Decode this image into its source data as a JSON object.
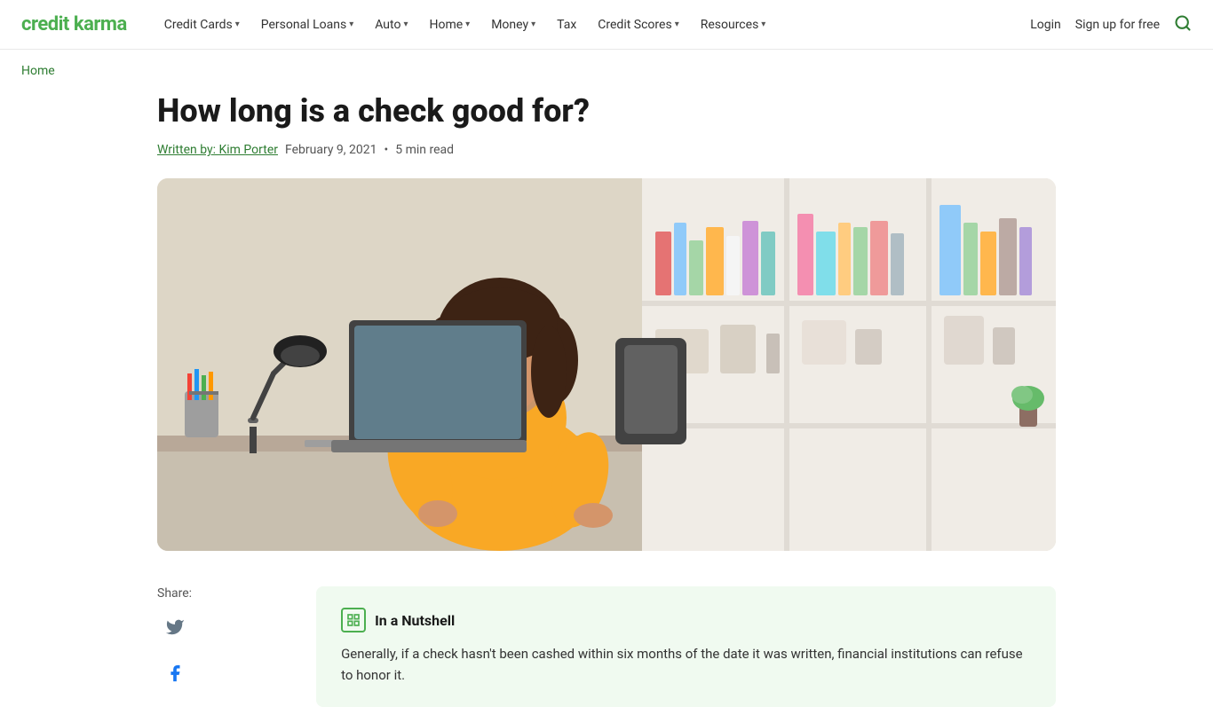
{
  "logo": {
    "text": "credit karma"
  },
  "nav": {
    "items": [
      {
        "label": "Credit Cards",
        "has_dropdown": true
      },
      {
        "label": "Personal Loans",
        "has_dropdown": true
      },
      {
        "label": "Auto",
        "has_dropdown": true
      },
      {
        "label": "Home",
        "has_dropdown": true
      },
      {
        "label": "Money",
        "has_dropdown": true
      },
      {
        "label": "Tax",
        "has_dropdown": false
      },
      {
        "label": "Credit Scores",
        "has_dropdown": true
      },
      {
        "label": "Resources",
        "has_dropdown": true
      }
    ],
    "login_label": "Login",
    "signup_label": "Sign up for free"
  },
  "breadcrumb": {
    "home_label": "Home"
  },
  "article": {
    "title": "How long is a check good for?",
    "author_label": "Written by: Kim Porter",
    "date": "February 9, 2021",
    "read_time": "5 min read",
    "dot_separator": "•"
  },
  "share": {
    "label": "Share:"
  },
  "nutshell": {
    "title": "In a Nutshell",
    "icon_symbol": "☐",
    "text": "Generally, if a check hasn't been cashed within six months of the date it was written, financial institutions can refuse to honor it."
  },
  "colors": {
    "green": "#4caf50",
    "dark_green": "#2e7d32",
    "light_green_bg": "#f0faf0"
  },
  "books": [
    {
      "color": "#e57373",
      "height": "60%"
    },
    {
      "color": "#90caf9",
      "height": "80%"
    },
    {
      "color": "#a5d6a7",
      "height": "50%"
    },
    {
      "color": "#ffb74d",
      "height": "70%"
    },
    {
      "color": "#ce93d8",
      "height": "65%"
    },
    {
      "color": "#80cbc4",
      "height": "75%"
    },
    {
      "color": "#f48fb1",
      "height": "55%"
    },
    {
      "color": "#bcaaa4",
      "height": "85%"
    },
    {
      "color": "#e8e0d0",
      "height": "45%"
    }
  ]
}
